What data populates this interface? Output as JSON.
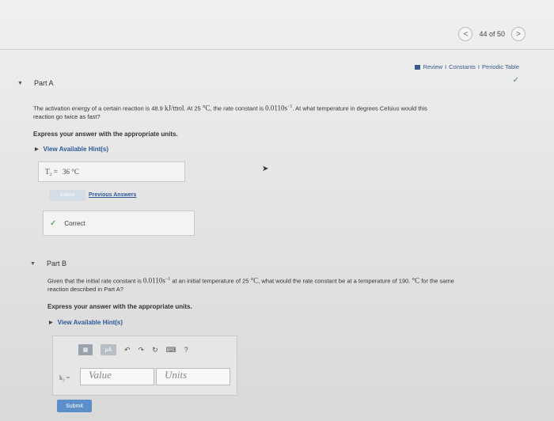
{
  "pager": {
    "prev": "<",
    "label": "44 of 50",
    "next": ">"
  },
  "top_links": {
    "review": "Review",
    "sep1": "I",
    "constants": "Constants",
    "sep2": "I",
    "periodic": "Periodic Table"
  },
  "part_a": {
    "title": "Part A",
    "question_1": "The activation energy of a certain reaction is 48.9",
    "unit_energy": "kJ/mol",
    "question_2": ". At 25",
    "unit_deg": "°C",
    "question_3": ", the rate constant is",
    "rate_value": "0.0110s",
    "rate_exp": "−1",
    "question_4": ". At what temperature in degrees Celsius would this",
    "question_5": "reaction go twice as fast?",
    "instruction": "Express your answer with the appropriate units.",
    "hints": "View Available Hint(s)",
    "answer_label": "T₂ =",
    "answer_value": "36 °C",
    "submit": "Submit",
    "previous_answers": "Previous Answers",
    "correct": "Correct"
  },
  "part_b": {
    "title": "Part B",
    "question_1": "Given that the initial rate constant is",
    "rate_value": "0.0110s",
    "rate_exp": "−1",
    "question_2": "at an initial temperature of 25",
    "unit_deg": "°C",
    "question_3": ", what would the rate constant be at a temperature of 190.",
    "unit_deg_2": "°C",
    "question_4": "for the same",
    "question_5": "reaction described in Part A?",
    "instruction": "Express your answer with the appropriate units.",
    "hints": "View Available Hint(s)",
    "k_label": "k₂ =",
    "value_placeholder": "Value",
    "units_placeholder": "Units",
    "submit": "Submit",
    "toolbar_mu": "μA",
    "toolbar_help": "?"
  }
}
